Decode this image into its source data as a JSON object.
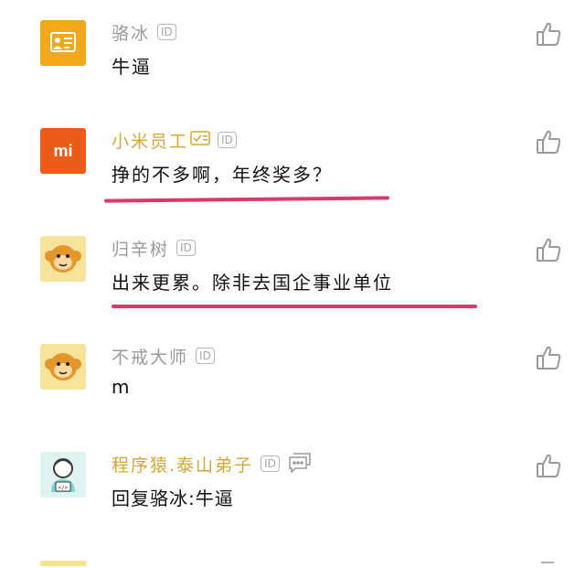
{
  "comments": [
    {
      "name": "骆冰",
      "badge": "ID",
      "text": "牛逼",
      "avatar": "id-card-avatar-icon",
      "name_color": "#9a9a9a"
    },
    {
      "name": "小米员工",
      "badge": "ID",
      "text": "挣的不多啊，年终奖多？",
      "avatar": "mi-logo-icon",
      "name_color": "#d9a630",
      "avatar_text": "mi"
    },
    {
      "name": "归辛树",
      "badge": "ID",
      "text": "出来更累。除非去国企事业单位",
      "avatar": "monkey-avatar-icon",
      "name_color": "#9a9a9a"
    },
    {
      "name": "不戒大师",
      "badge": "ID",
      "text": "m",
      "avatar": "monkey-avatar-icon",
      "name_color": "#9a9a9a"
    },
    {
      "name": "程序猿.泰山弟子",
      "badge": "ID",
      "text": "回复骆冰:牛逼",
      "avatar": "coder-avatar-icon",
      "name_color": "#d9a630"
    }
  ],
  "colors": {
    "accent_underline": "#d93a6a",
    "name_gold": "#d9a630",
    "avatar_orange": "#f3a81c",
    "mi_orange": "#ea5c18"
  }
}
